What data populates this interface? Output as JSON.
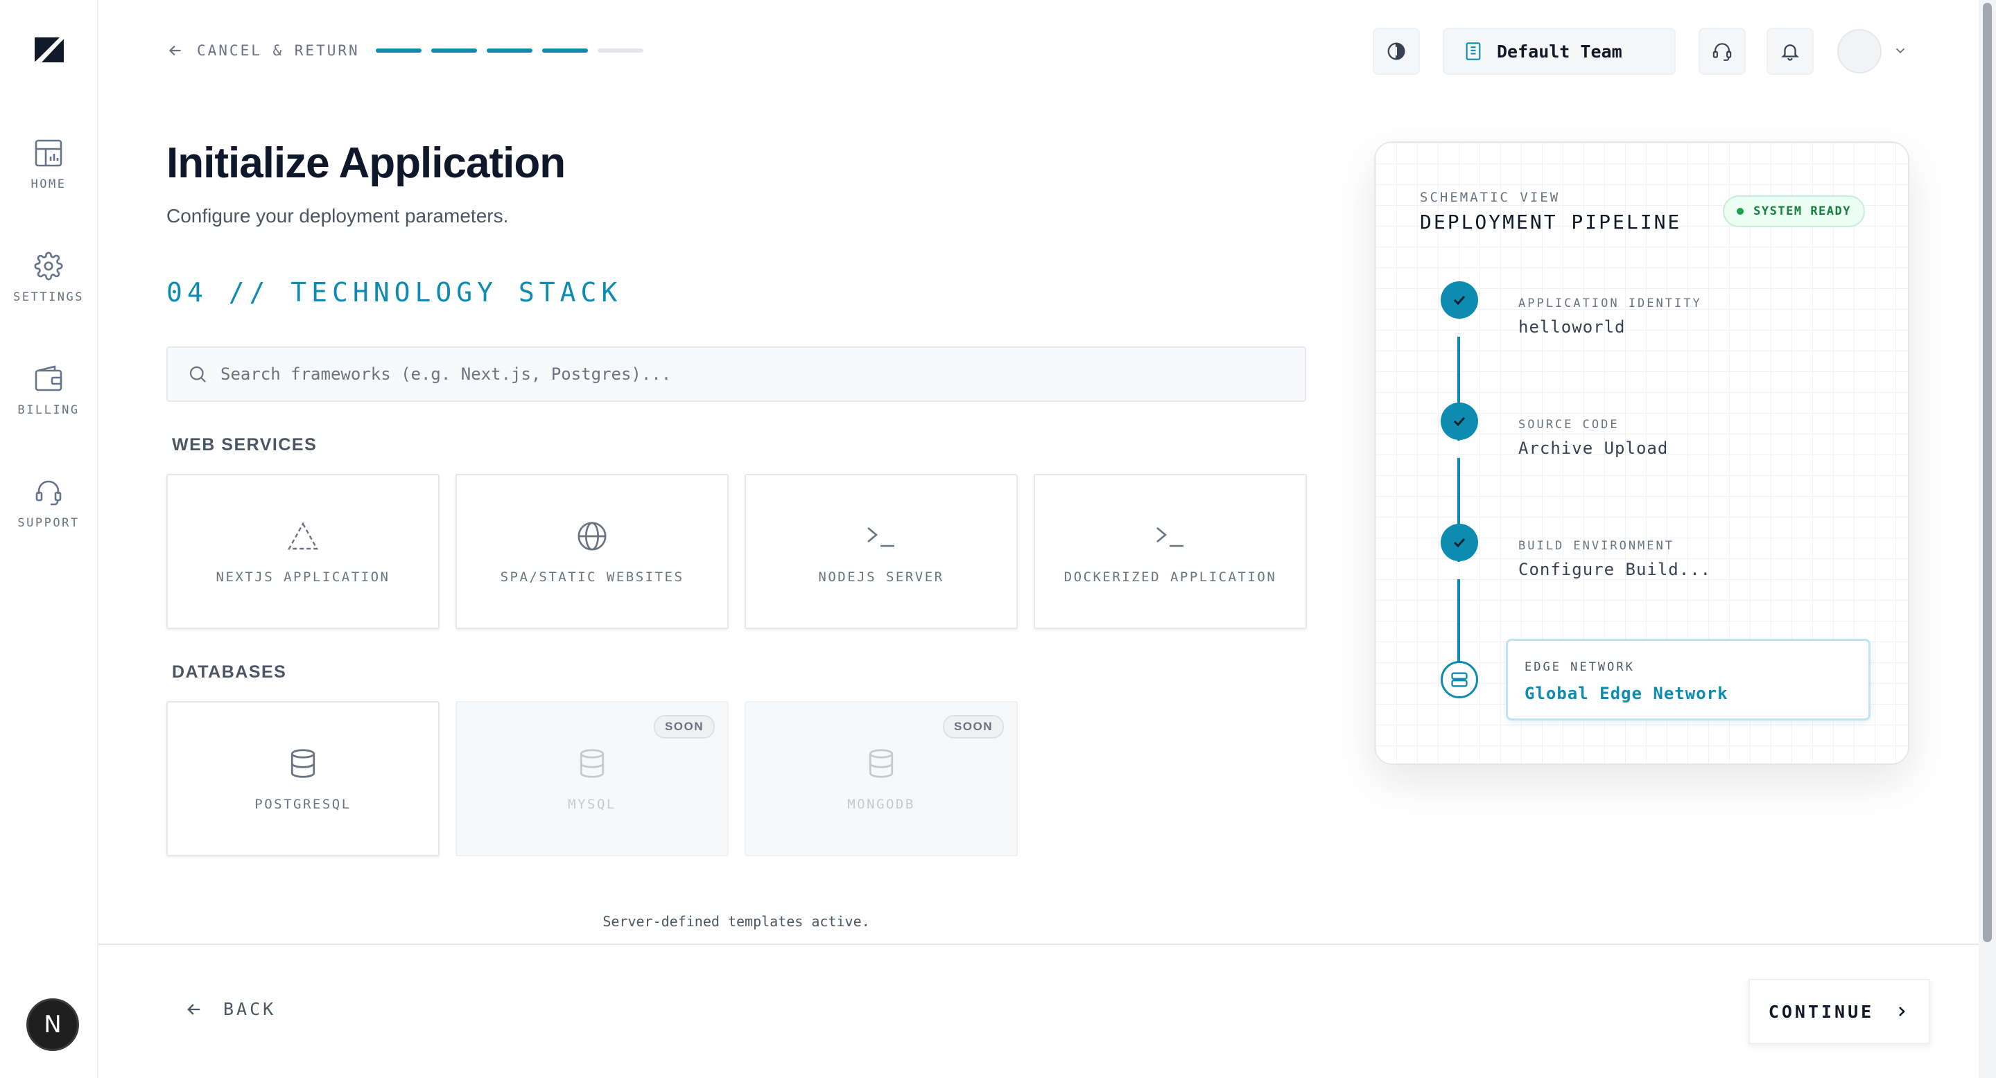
{
  "sidebar": {
    "items": [
      {
        "label": "HOME",
        "icon": "dashboard-icon"
      },
      {
        "label": "SETTINGS",
        "icon": "gear-icon"
      },
      {
        "label": "BILLING",
        "icon": "wallet-icon"
      },
      {
        "label": "SUPPORT",
        "icon": "headset-icon"
      }
    ],
    "avatar_initial": "N"
  },
  "topbar": {
    "cancel_label": "CANCEL & RETURN",
    "progress": {
      "completed_steps": 4,
      "total_steps": 5
    },
    "team_name": "Default Team"
  },
  "main": {
    "title": "Initialize Application",
    "subtitle": "Configure your deployment parameters.",
    "section_heading": "04 // TECHNOLOGY STACK",
    "search": {
      "placeholder": "Search frameworks (e.g. Next.js, Postgres)..."
    },
    "web_services": {
      "label": "WEB SERVICES",
      "cards": [
        {
          "label": "NEXTJS APPLICATION",
          "icon": "triangle-icon"
        },
        {
          "label": "SPA/STATIC WEBSITES",
          "icon": "globe-icon"
        },
        {
          "label": "NODEJS SERVER",
          "icon": "terminal-icon"
        },
        {
          "label": "DOCKERIZED APPLICATION",
          "icon": "terminal-icon"
        }
      ]
    },
    "databases": {
      "label": "DATABASES",
      "cards": [
        {
          "label": "POSTGRESQL",
          "icon": "database-icon",
          "badge": ""
        },
        {
          "label": "MYSQL",
          "icon": "database-icon",
          "badge": "SOON"
        },
        {
          "label": "MONGODB",
          "icon": "database-icon",
          "badge": "SOON"
        }
      ]
    },
    "footnote": "Server-defined templates active."
  },
  "footer": {
    "back_label": "BACK",
    "continue_label": "CONTINUE"
  },
  "pipeline": {
    "subtitle": "SCHEMATIC VIEW",
    "title": "DEPLOYMENT PIPELINE",
    "status": "SYSTEM READY",
    "steps": [
      {
        "label": "APPLICATION IDENTITY",
        "value": "helloworld",
        "state": "done"
      },
      {
        "label": "SOURCE CODE",
        "value": "Archive Upload",
        "state": "done"
      },
      {
        "label": "BUILD ENVIRONMENT",
        "value": "Configure Build...",
        "state": "done"
      },
      {
        "label": "EDGE NETWORK",
        "value": "Global Edge Network",
        "state": "current"
      }
    ]
  },
  "colors": {
    "accent": "#0e8bb0",
    "status_green": "#16a34a",
    "text_primary": "#0f172a"
  }
}
